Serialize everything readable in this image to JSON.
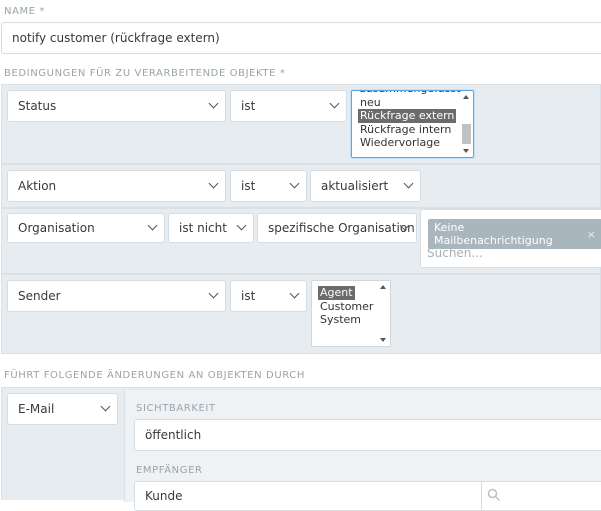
{
  "name_label": "NAME *",
  "name_value": "notify customer (rückfrage extern)",
  "conditions_label": "BEDINGUNGEN FÜR ZU VERARBEITENDE OBJEKTE *",
  "conditions": {
    "status": {
      "attribute": "Status",
      "operator": "ist",
      "options": [
        "zusammengefasst",
        "neu",
        "Rückfrage extern",
        "Rückfrage intern",
        "Wiedervorlage"
      ],
      "selected": "Rückfrage extern"
    },
    "aktion": {
      "attribute": "Aktion",
      "operator": "ist",
      "value": "aktualisiert"
    },
    "organisation": {
      "attribute": "Organisation",
      "operator": "ist nicht",
      "value": "spezifische Organisation",
      "chip": "Keine Mailbenachrichtigung",
      "chip_remove": "×",
      "search_placeholder": "Suchen..."
    },
    "sender": {
      "attribute": "Sender",
      "operator": "ist",
      "options": [
        "Agent",
        "Customer",
        "System"
      ],
      "selected": "Agent"
    }
  },
  "actions_label": "FÜHRT FOLGENDE ÄNDERUNGEN AN OBJEKTEN DURCH",
  "actions": {
    "type": "E-Mail",
    "visibility_label": "SICHTBARKEIT",
    "visibility_value": "öffentlich",
    "recipient_label": "EMPFÄNGER",
    "recipient_value": "Kunde"
  },
  "colors": {
    "row_bg": "#e6ecef",
    "label": "#9aa4ab",
    "chip": "#a9b6bd",
    "focus": "#5aa9e6"
  }
}
